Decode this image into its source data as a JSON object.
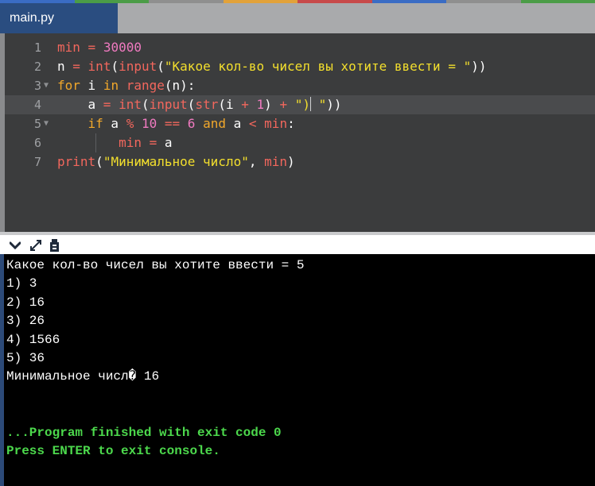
{
  "tab": {
    "title": "main.py"
  },
  "colors": {
    "tab_bg": "#2a4d80",
    "editor_bg": "#3b3c3d",
    "keyword": "#f2a82b",
    "name": "#f2675d",
    "number": "#f07ac0",
    "string": "#f3df2d",
    "console_bg": "#000000",
    "console_finished": "#4cd84c"
  },
  "editor": {
    "active_line": 4,
    "lines": [
      {
        "num": "1",
        "fold": "",
        "tokens": [
          {
            "t": "min",
            "c": "nm"
          },
          {
            "t": " = ",
            "c": "op"
          },
          {
            "t": "30000",
            "c": "num"
          }
        ]
      },
      {
        "num": "2",
        "fold": "",
        "tokens": [
          {
            "t": "n",
            "c": "var"
          },
          {
            "t": " = ",
            "c": "op"
          },
          {
            "t": "int",
            "c": "fn"
          },
          {
            "t": "(",
            "c": "var"
          },
          {
            "t": "input",
            "c": "fn"
          },
          {
            "t": "(",
            "c": "var"
          },
          {
            "t": "\"Какое кол-во чисел вы хотите ввести = \"",
            "c": "str"
          },
          {
            "t": "))",
            "c": "var"
          }
        ]
      },
      {
        "num": "3",
        "fold": "▼",
        "tokens": [
          {
            "t": "for",
            "c": "kw"
          },
          {
            "t": " i ",
            "c": "var"
          },
          {
            "t": "in",
            "c": "kw"
          },
          {
            "t": " ",
            "c": "var"
          },
          {
            "t": "range",
            "c": "fn"
          },
          {
            "t": "(n):",
            "c": "var"
          }
        ]
      },
      {
        "num": "4",
        "fold": "",
        "tokens": [
          {
            "t": "    a",
            "c": "var"
          },
          {
            "t": " = ",
            "c": "op"
          },
          {
            "t": "int",
            "c": "fn"
          },
          {
            "t": "(",
            "c": "var"
          },
          {
            "t": "input",
            "c": "fn"
          },
          {
            "t": "(",
            "c": "var"
          },
          {
            "t": "str",
            "c": "fn"
          },
          {
            "t": "(i ",
            "c": "var"
          },
          {
            "t": "+",
            "c": "op"
          },
          {
            "t": " ",
            "c": "var"
          },
          {
            "t": "1",
            "c": "num"
          },
          {
            "t": ") ",
            "c": "var"
          },
          {
            "t": "+",
            "c": "op"
          },
          {
            "t": " ",
            "c": "var"
          },
          {
            "t": "\")",
            "c": "str"
          },
          {
            "t": "CURSOR",
            "c": "cursor"
          },
          {
            "t": " \"",
            "c": "str"
          },
          {
            "t": "))",
            "c": "var"
          }
        ]
      },
      {
        "num": "5",
        "fold": "▼",
        "tokens": [
          {
            "t": "    if",
            "c": "kw"
          },
          {
            "t": " a ",
            "c": "var"
          },
          {
            "t": "%",
            "c": "op"
          },
          {
            "t": " ",
            "c": "var"
          },
          {
            "t": "10",
            "c": "num"
          },
          {
            "t": " ",
            "c": "var"
          },
          {
            "t": "==",
            "c": "op"
          },
          {
            "t": " ",
            "c": "var"
          },
          {
            "t": "6",
            "c": "num"
          },
          {
            "t": " ",
            "c": "var"
          },
          {
            "t": "and",
            "c": "kw"
          },
          {
            "t": " a ",
            "c": "var"
          },
          {
            "t": "<",
            "c": "op"
          },
          {
            "t": " ",
            "c": "var"
          },
          {
            "t": "min",
            "c": "nm"
          },
          {
            "t": ":",
            "c": "var"
          }
        ]
      },
      {
        "num": "6",
        "fold": "",
        "tokens": [
          {
            "t": "        min",
            "c": "nm"
          },
          {
            "t": " = ",
            "c": "op"
          },
          {
            "t": "a",
            "c": "var"
          }
        ]
      },
      {
        "num": "7",
        "fold": "",
        "tokens": [
          {
            "t": "print",
            "c": "fn"
          },
          {
            "t": "(",
            "c": "var"
          },
          {
            "t": "\"Минимальное число\"",
            "c": "str"
          },
          {
            "t": ", ",
            "c": "var"
          },
          {
            "t": "min",
            "c": "nm"
          },
          {
            "t": ")",
            "c": "var"
          }
        ]
      }
    ]
  },
  "console_toolbar": {
    "collapse_icon": "chevron-down-icon",
    "expand_icon": "expand-arrows-icon",
    "copy_icon": "copy-clipboard-icon"
  },
  "console": {
    "lines": [
      "Какое кол-во чисел вы хотите ввести = 5",
      "1) 3",
      "2) 16",
      "3) 26",
      "4) 1566",
      "5) 36",
      "Минимальное числ� 16",
      "",
      "",
      "...Program finished with exit code 0",
      "Press ENTER to exit console."
    ],
    "finished_from": 9
  }
}
